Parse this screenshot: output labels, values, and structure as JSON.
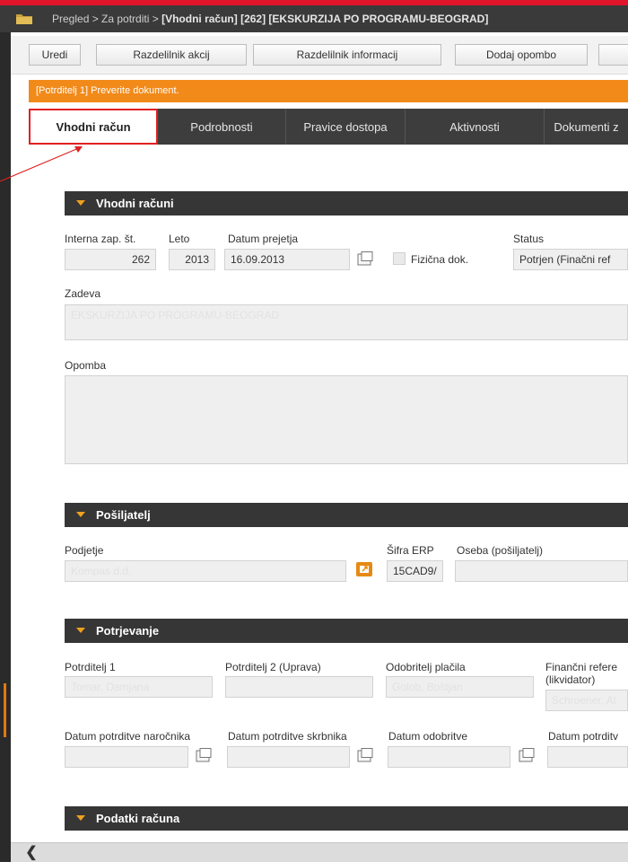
{
  "header": {
    "crumb_prefix": "Pregled > Za potrditi > ",
    "crumb_current": "[Vhodni račun] [262] [EKSKURZIJA PO PROGRAMU-BEOGRAD]"
  },
  "toolbar": {
    "edit_label": "Uredi",
    "action_dist_label": "Razdelilnik akcij",
    "info_dist_label": "Razdelilnik informacij",
    "add_note_label": "Dodaj opombo"
  },
  "notice": {
    "text": "[Potrditelj 1] Preverite dokument."
  },
  "tabs": [
    {
      "label": "Vhodni račun",
      "active": true
    },
    {
      "label": "Podrobnosti"
    },
    {
      "label": "Pravice dostopa"
    },
    {
      "label": "Aktivnosti"
    },
    {
      "label": "Dokumenti z"
    }
  ],
  "sections": {
    "invoices": {
      "title": "Vhodni računi"
    },
    "sender": {
      "title": "Pošiljatelj"
    },
    "confirmation": {
      "title": "Potrjevanje"
    },
    "invoice_data": {
      "title": "Podatki računa"
    }
  },
  "invoice": {
    "internal_no_label": "Interna zap. št.",
    "internal_no": "262",
    "year_label": "Leto",
    "year": "2013",
    "received_date_label": "Datum prejetja",
    "received_date": "16.09.2013",
    "physical_doc_label": "Fizična dok.",
    "status_label": "Status",
    "status": "Potrjen (Finačni ref",
    "subject_label": "Zadeva",
    "subject": "EKSKURZIJA PO PROGRAMU-BEOGRAD",
    "note_label": "Opomba"
  },
  "sender": {
    "company_label": "Podjetje",
    "company": "Kompas d.d.",
    "erp_label": "Šifra ERP",
    "erp": "15CAD9/",
    "person_label": "Oseba (pošiljatelj)"
  },
  "confirmation": {
    "confirmer1_label": "Potrditelj 1",
    "confirmer1": "Tomar, Damjana",
    "confirmer2_label": "Potrditelj 2 (Uprava)",
    "payment_approver_label": "Odobritelj plačila",
    "payment_approver": "Golob, Boštjan",
    "fin_ref_label_1": "Finančni refere",
    "fin_ref_label_2": "(likvidator)",
    "fin_ref": "Schroener, Al",
    "date_customer_label": "Datum potrditve naročnika",
    "date_guardian_label": "Datum potrditve skrbnika",
    "date_approval_label": "Datum odobritve",
    "date_confirm_label": "Datum potrditv"
  },
  "colors": {
    "brand_red": "#e0152b",
    "notice_orange": "#f28a1a",
    "section_dark": "#363636",
    "accent_yellow": "#f0a020"
  },
  "icons": {
    "app": "folder-icon",
    "calendar": "calendar-icon",
    "link": "open-link-icon",
    "scroll_left": "chevron-left-icon"
  }
}
